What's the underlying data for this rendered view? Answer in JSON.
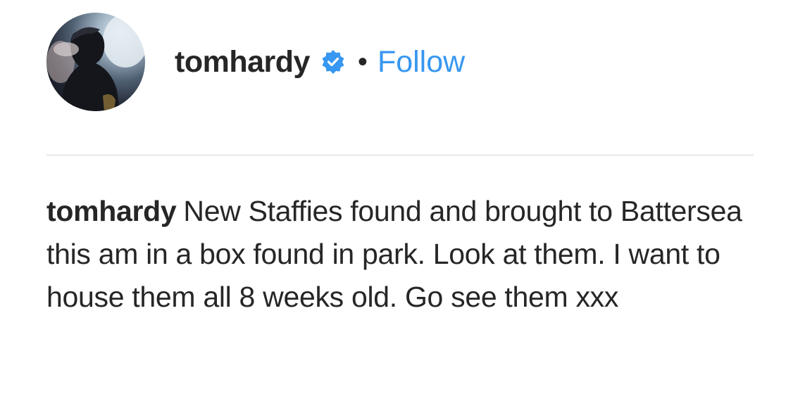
{
  "post_header": {
    "username": "tomhardy",
    "separator": "•",
    "follow_label": "Follow",
    "verified_icon": "verified-badge-icon",
    "accent_color": "#3897f0"
  },
  "caption": {
    "username": "tomhardy",
    "text": "New Staffies found and brought to Battersea this am in a box found in park. Look at them. I want to house them all 8 weeks old. Go see them xxx"
  }
}
